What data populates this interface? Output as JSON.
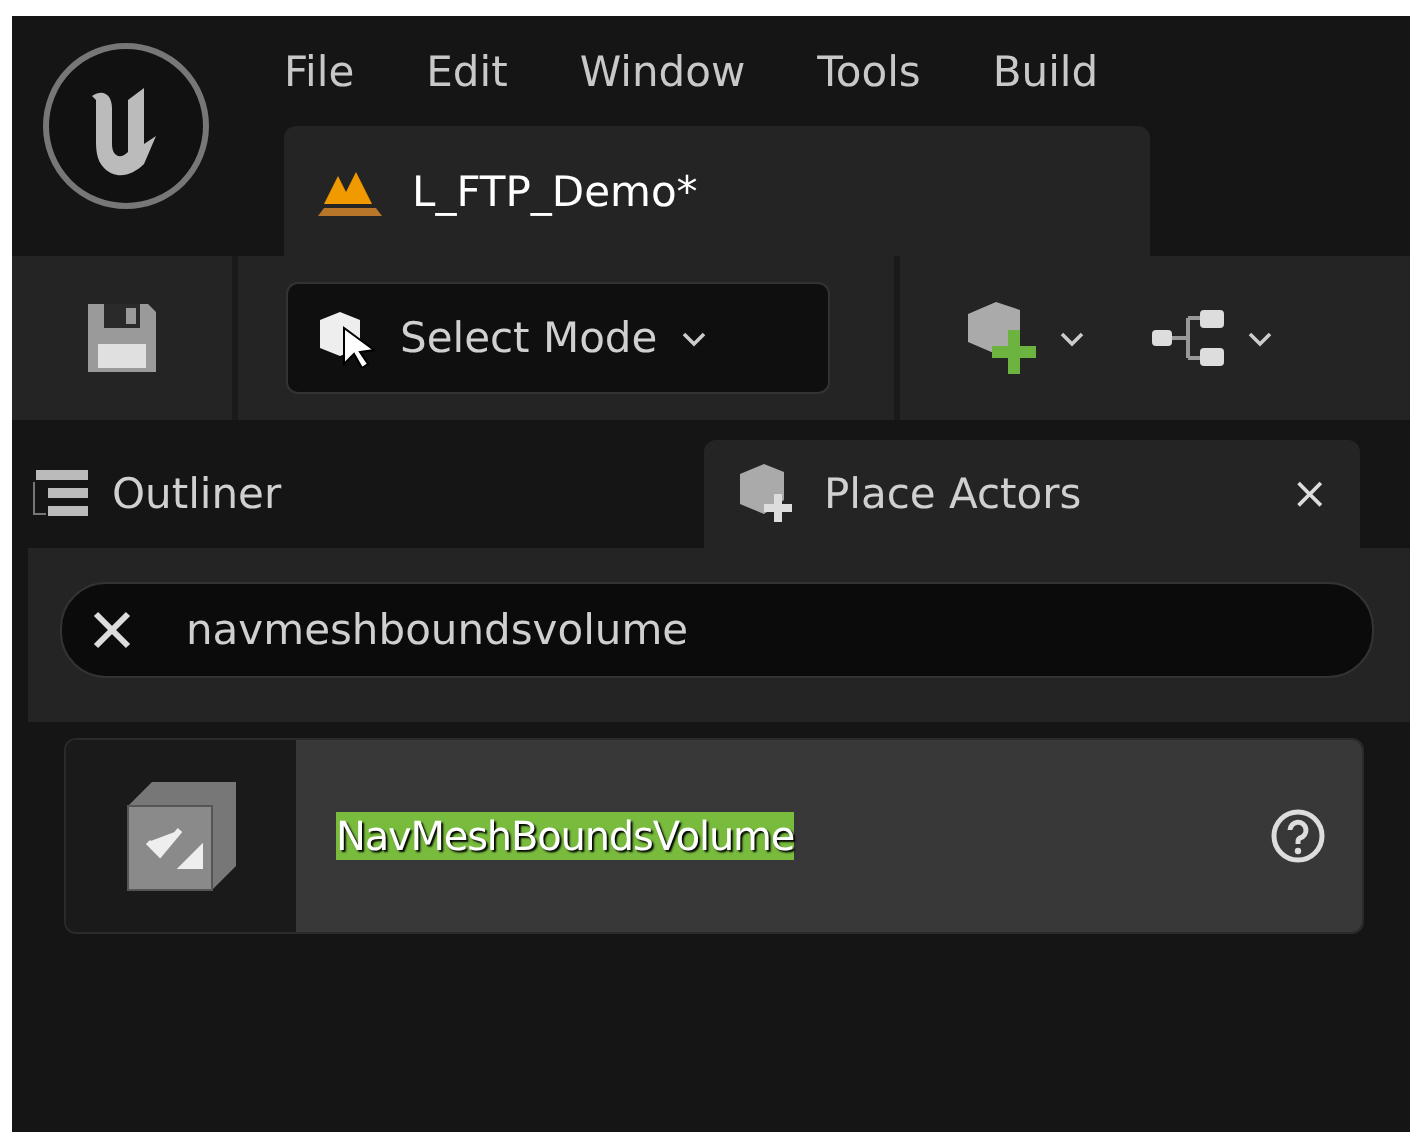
{
  "menu": [
    "File",
    "Edit",
    "Window",
    "Tools",
    "Build"
  ],
  "document_tab": {
    "title": "L_FTP_Demo*"
  },
  "toolbar": {
    "mode_button": "Select Mode"
  },
  "panel_tabs": [
    {
      "label": "Outliner",
      "selected": false
    },
    {
      "label": "Place Actors",
      "selected": true,
      "close": "×"
    }
  ],
  "search": {
    "value": "navmeshboundsvolume"
  },
  "results": [
    {
      "name": "NavMeshBoundsVolume",
      "highlighted": true
    }
  ]
}
